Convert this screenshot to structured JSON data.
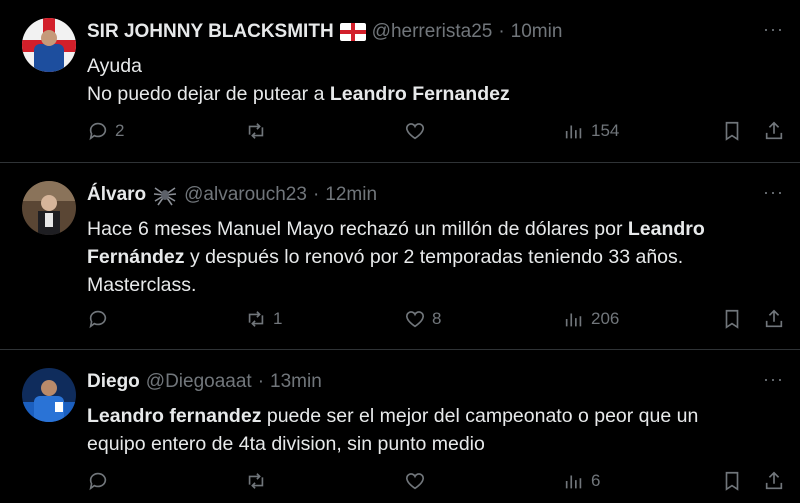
{
  "colors": {
    "background": "#000000",
    "text": "#e7e9ea",
    "muted": "#71767b",
    "divider": "#2f3336"
  },
  "tweets": [
    {
      "name": "SIR JOHNNY BLACKSMITH",
      "badge_icon": "england-flag-icon",
      "handle": "@herrerista25",
      "dot": "·",
      "time": "10min",
      "more": "···",
      "lines": [
        {
          "parts": [
            {
              "t": "Ayuda",
              "b": false
            }
          ]
        },
        {
          "parts": [
            {
              "t": "No puedo dejar de putear a ",
              "b": false
            },
            {
              "t": "Leandro Fernandez",
              "b": true
            }
          ]
        }
      ],
      "replies": "2",
      "retweets": "",
      "likes": "",
      "views": "154"
    },
    {
      "name": "Álvaro",
      "badge_icon": "spider-icon",
      "handle": "@alvarouch23",
      "dot": "·",
      "time": "12min",
      "more": "···",
      "lines": [
        {
          "parts": [
            {
              "t": "Hace 6 meses Manuel Mayo rechazó un millón de dólares por ",
              "b": false
            },
            {
              "t": "Leandro",
              "b": true
            }
          ]
        },
        {
          "parts": [
            {
              "t": "Fernández",
              "b": true
            },
            {
              "t": " y después lo renovó por 2 temporadas teniendo 33 años.",
              "b": false
            }
          ]
        },
        {
          "parts": [
            {
              "t": "Masterclass.",
              "b": false
            }
          ]
        }
      ],
      "replies": "",
      "retweets": "1",
      "likes": "8",
      "views": "206"
    },
    {
      "name": "Diego",
      "badge_icon": "",
      "handle": "@Diegoaaat",
      "dot": "·",
      "time": "13min",
      "more": "···",
      "lines": [
        {
          "parts": [
            {
              "t": "Leandro fernandez",
              "b": true
            },
            {
              "t": " puede ser el mejor del campeonato o peor que un",
              "b": false
            }
          ]
        },
        {
          "parts": [
            {
              "t": "equipo entero de 4ta division, sin punto medio",
              "b": false
            }
          ]
        }
      ],
      "replies": "",
      "retweets": "",
      "likes": "",
      "views": "6"
    }
  ]
}
